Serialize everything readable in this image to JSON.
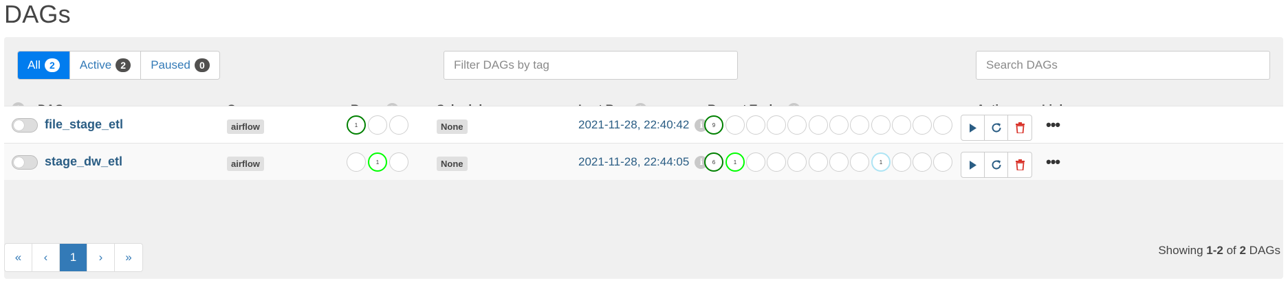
{
  "page": {
    "title": "DAGs"
  },
  "filters": {
    "status": [
      {
        "label": "All",
        "count": "2"
      },
      {
        "label": "Active",
        "count": "2"
      },
      {
        "label": "Paused",
        "count": "0"
      }
    ],
    "tag_placeholder": "Filter DAGs by tag",
    "search_placeholder": "Search DAGs"
  },
  "table": {
    "headers": {
      "dag": "DAG",
      "owner": "Owner",
      "runs": "Runs",
      "schedule": "Schedule",
      "last_run": "Last Run",
      "recent_tasks": "Recent Tasks",
      "actions": "Actions",
      "links": "Links"
    },
    "rows": [
      {
        "dag_id": "file_stage_etl",
        "owner": "airflow",
        "schedule": "None",
        "last_run": "2021-11-28, 22:40:42",
        "runs": [
          "1",
          "",
          ""
        ],
        "tasks": [
          "9",
          "",
          "",
          "",
          "",
          "",
          "",
          "",
          "",
          "",
          "",
          ""
        ]
      },
      {
        "dag_id": "stage_dw_etl",
        "owner": "airflow",
        "schedule": "None",
        "last_run": "2021-11-28, 22:44:05",
        "runs": [
          "",
          "1",
          ""
        ],
        "tasks": [
          "6",
          "1",
          "",
          "",
          "",
          "",
          "",
          "",
          "1",
          "",
          "",
          ""
        ]
      }
    ]
  },
  "icons": {
    "info": "info-icon",
    "trigger": "play-icon",
    "refresh": "refresh-icon",
    "delete": "trash-icon",
    "links": "more-icon"
  },
  "colors": {
    "success": "#008000",
    "running": "#00ff00",
    "upstream_failed_or_queued": "#ade4f4",
    "primary": "#017cee",
    "delete": "#d9342b"
  },
  "pagination": {
    "first": "«",
    "prev": "‹",
    "current": "1",
    "next": "›",
    "last": "»"
  },
  "footer": {
    "showing_prefix": "Showing ",
    "range": "1-2",
    "of_word": " of ",
    "total": "2",
    "suffix": " DAGs"
  }
}
